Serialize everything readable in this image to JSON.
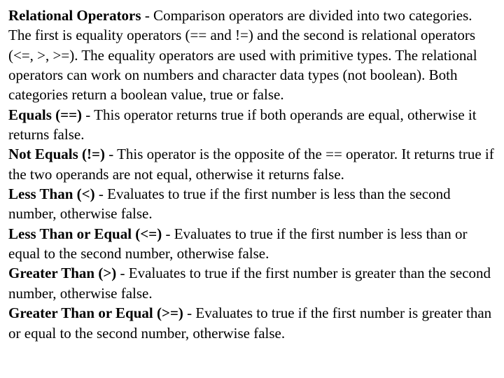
{
  "doc": {
    "relational_operators_heading": "Relational Operators",
    "relational_operators_body": " - Comparison operators are divided into two categories. The first is equality operators (== and !=) and the second is relational operators (<=, >, >=). The equality operators are used with primitive types. The relational operators can work on numbers and character data types (not boolean). Both categories return a boolean value, true or false.",
    "equals_heading": "Equals (==)",
    "equals_body": " - This operator returns true if both operands are equal, otherwise it returns false.",
    "not_equals_heading": "Not Equals (!=)",
    "not_equals_body": " - This operator is the opposite of the == operator. It returns true if the two operands are not equal, otherwise it returns false.",
    "less_than_heading": "Less Than (<)",
    "less_than_body": " - Evaluates to true if the first number is less than the second number, otherwise false.",
    "less_than_equal_heading": "Less Than or Equal (<=)",
    "less_than_equal_body": " - Evaluates to true if the first number is less than or equal to the second number, otherwise false.",
    "greater_than_heading": "Greater Than (>)",
    "greater_than_body": " - Evaluates to true if the first number is greater than the second number, otherwise false.",
    "greater_than_equal_heading": "Greater Than or Equal (>=) ",
    "greater_than_equal_body": " - Evaluates to true if the first number is greater than or equal to the second number, otherwise false."
  }
}
